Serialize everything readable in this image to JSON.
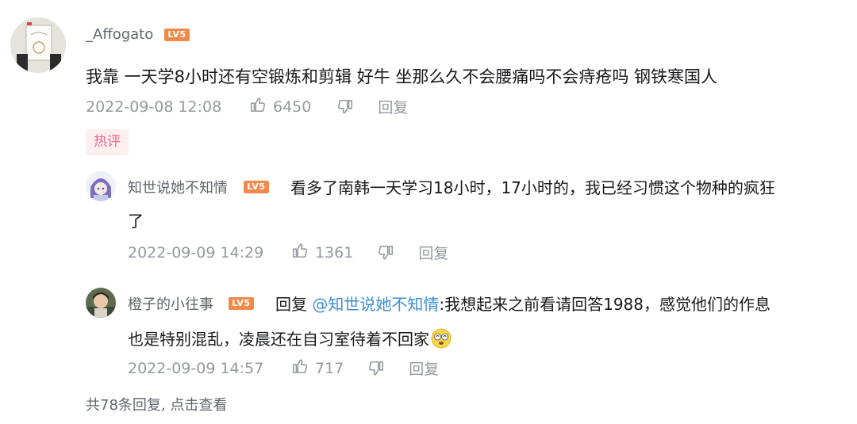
{
  "main_comment": {
    "username": "_Affogato",
    "level_badge": "LV5",
    "text": "我靠 一天学8小时还有空锻炼和剪辑 好牛 坐那么久不会腰痛吗不会痔疮吗 钢铁寒国人",
    "time": "2022-09-08 12:08",
    "likes": "6450",
    "reply_label": "回复",
    "hot_tag": "热评"
  },
  "replies": [
    {
      "username": "知世说她不知情",
      "level_badge": "LV5",
      "text_line1": "看多了南韩一天学习18小时，17小时的，我已经习惯这个物种的疯狂",
      "text_line2": "了",
      "time": "2022-09-09 14:29",
      "likes": "1361",
      "reply_label": "回复"
    },
    {
      "username": "橙子的小往事",
      "level_badge": "LV5",
      "reply_prefix": "回复",
      "mention": "@知世说她不知情",
      "text_line1": ":我想起来之前看请回答1988，感觉他们的作息",
      "text_line2": "也是特别混乱，凌晨还在自习室待着不回家",
      "emoji": "dizzy-face-emoji",
      "time": "2022-09-09 14:57",
      "likes": "717",
      "reply_label": "回复"
    }
  ],
  "more_replies": "共78条回复, 点击查看",
  "colors": {
    "username": "#61666d",
    "text": "#18191c",
    "meta": "#9499a0",
    "level_badge": "#f08a4b",
    "hot_tag_bg": "#fdeef0",
    "hot_tag_text": "#ea6a8c",
    "mention": "#3d8fd6"
  }
}
